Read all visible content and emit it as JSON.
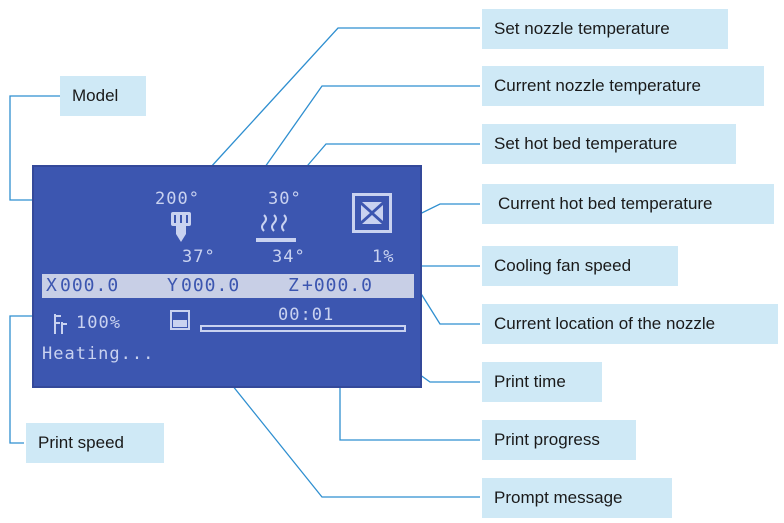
{
  "labels": {
    "set_nozzle_temperature": "Set nozzle temperature",
    "current_nozzle_temperature": "Current nozzle temperature",
    "set_hot_bed_temperature": "Set hot bed temperature",
    "current_hot_bed_temperature": "Current hot bed temperature",
    "cooling_fan_speed": "Cooling fan speed",
    "current_location": "Current location of the nozzle",
    "print_time": "Print time",
    "print_progress": "Print progress",
    "prompt_message": "Prompt message",
    "print_speed": "Print speed",
    "model": "Model"
  },
  "lcd": {
    "set_nozzle_temp": "200°",
    "current_nozzle_temp": "37°",
    "set_bed_temp": "30°",
    "current_bed_temp": "34°",
    "fan_speed": "1%",
    "x_label": "X",
    "x_value": "000.0",
    "y_label": "Y",
    "y_value": "000.0",
    "z_label": "Z",
    "z_value": "+000.0",
    "print_speed": "100%",
    "print_time": "00:01",
    "progress_fraction": 0.0,
    "message": "Heating..."
  },
  "colors": {
    "label_background": "#cfe9f6",
    "leader_line": "#2f8fd0",
    "lcd_background": "#3c56b0",
    "lcd_text": "#c9d2f0"
  },
  "icons": [
    "nozzle-icon",
    "heated-bed-icon",
    "fan-icon",
    "speed-icon",
    "sd-card-icon"
  ]
}
